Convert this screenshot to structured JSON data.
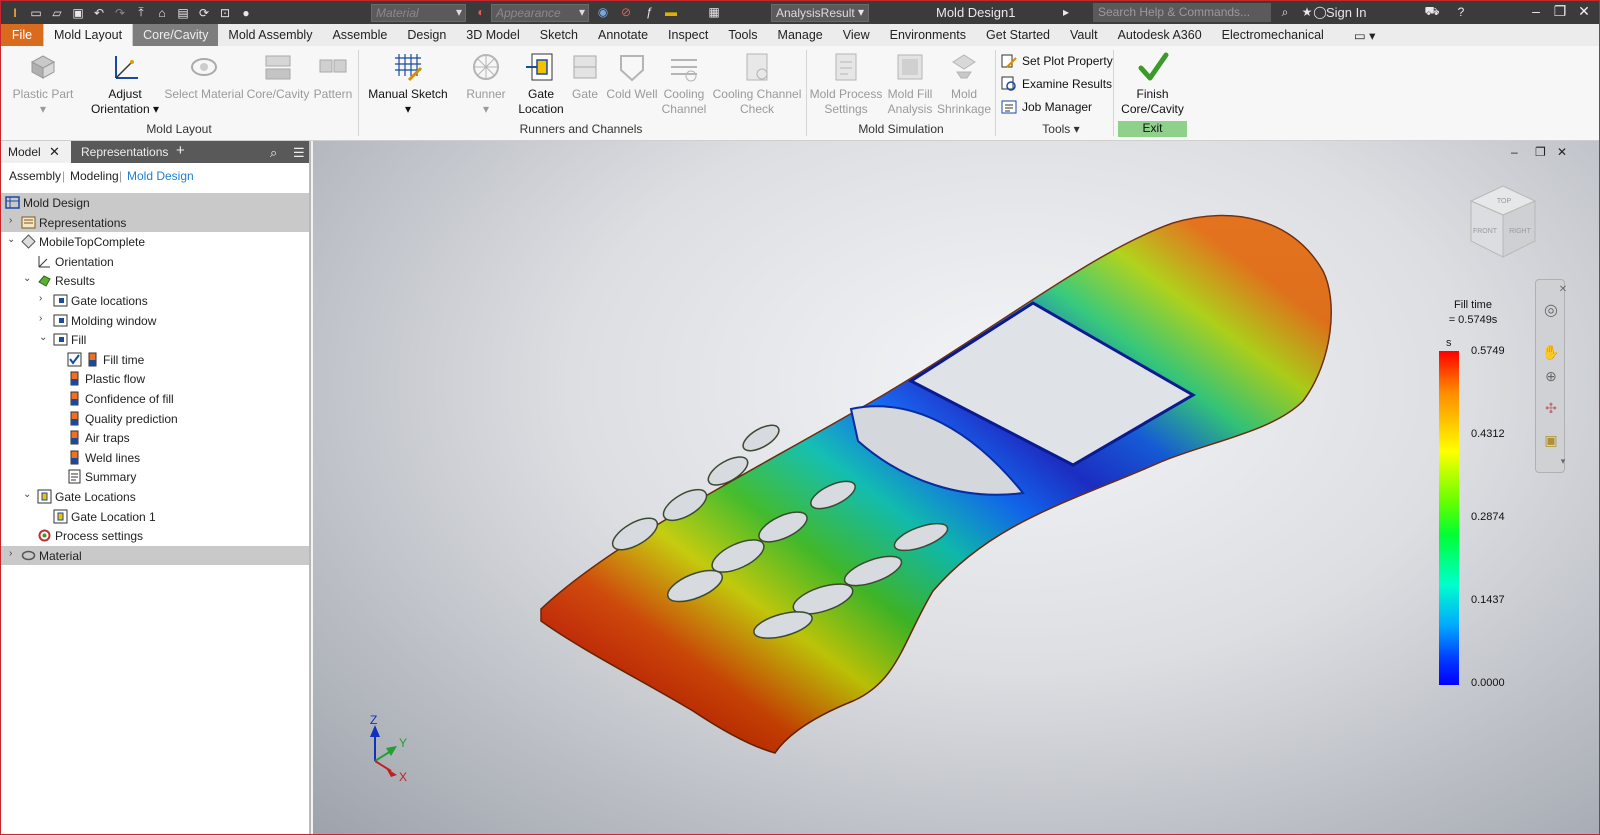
{
  "app": {
    "doc_title": "Mold Design1",
    "search_placeholder": "Search Help & Commands...",
    "sign_in": "Sign In",
    "material_placeholder": "Material",
    "appearance_placeholder": "Appearance",
    "analysis_value": "AnalysisResult"
  },
  "tabs": [
    "File",
    "Mold Layout",
    "Core/Cavity",
    "Mold Assembly",
    "Assemble",
    "Design",
    "3D Model",
    "Sketch",
    "Annotate",
    "Inspect",
    "Tools",
    "Manage",
    "View",
    "Environments",
    "Get Started",
    "Vault",
    "Autodesk A360",
    "Electromechanical"
  ],
  "ribbon": {
    "mold_layout": {
      "label": "Mold Layout",
      "plastic_part": "Plastic Part",
      "adjust_orientation_1": "Adjust",
      "adjust_orientation_2": "Orientation",
      "select_material": "Select Material",
      "core_cavity": "Core/Cavity",
      "pattern": "Pattern"
    },
    "runners": {
      "label": "Runners and Channels",
      "manual_sketch": "Manual Sketch",
      "runner": "Runner",
      "gate_location_1": "Gate",
      "gate_location_2": "Location",
      "gate": "Gate",
      "cold_well": "Cold Well",
      "cooling_channel_1": "Cooling",
      "cooling_channel_2": "Channel",
      "cooling_check_1": "Cooling Channel",
      "cooling_check_2": "Check"
    },
    "mold_sim": {
      "label": "Mold Simulation",
      "process_1": "Mold Process",
      "process_2": "Settings",
      "fill_1": "Mold Fill",
      "fill_2": "Analysis",
      "shrink_1": "Mold",
      "shrink_2": "Shrinkage"
    },
    "tools": {
      "label": "Tools",
      "set_plot": "Set Plot Property",
      "examine": "Examine Results",
      "job_manager": "Job Manager"
    },
    "exit": {
      "label": "Exit",
      "finish_1": "Finish",
      "finish_2": "Core/Cavity"
    }
  },
  "browser": {
    "tab_model": "Model",
    "tab_representations": "Representations",
    "subtabs": [
      "Assembly",
      "Modeling",
      "Mold Design"
    ],
    "tree": [
      "Mold Design",
      "Representations",
      "MobileTopComplete",
      "Orientation",
      "Results",
      "Gate locations",
      "Molding window",
      "Fill",
      "Fill time",
      "Plastic flow",
      "Confidence of fill",
      "Quality prediction",
      "Air traps",
      "Weld lines",
      "Summary",
      "Gate Locations",
      "Gate Location 1",
      "Process settings",
      "Material"
    ]
  },
  "legend": {
    "title": "Fill time",
    "value": "= 0.5749s",
    "unit": "s",
    "ticks": [
      "0.5749",
      "0.4312",
      "0.2874",
      "0.1437",
      "0.0000"
    ]
  },
  "viewcube": {
    "top": "TOP",
    "front": "FRONT",
    "right": "RIGHT"
  },
  "axes": {
    "z": "Z",
    "y": "Y",
    "x": "X"
  },
  "colors": {
    "file_tab": "#d86b1e",
    "exit_bar": "#8fd08a",
    "selection": "#c9c9c9"
  }
}
